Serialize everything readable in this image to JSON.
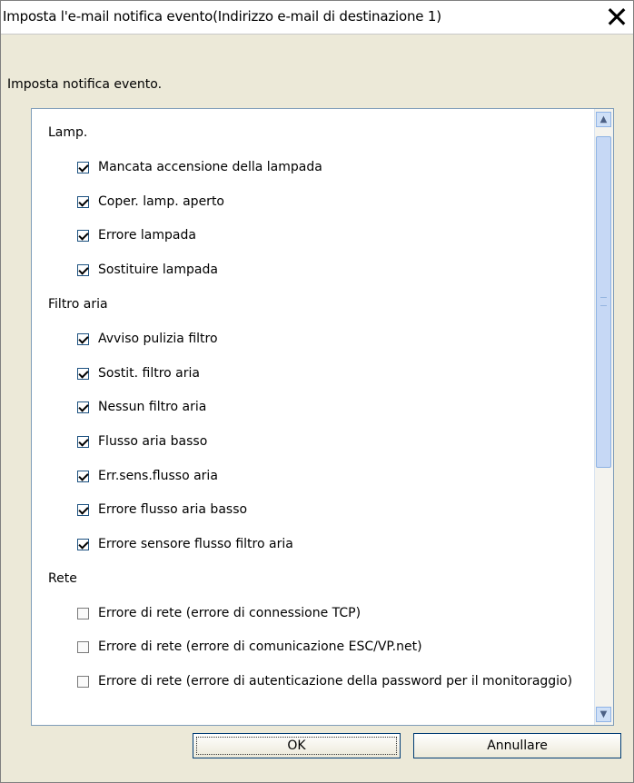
{
  "window": {
    "title": "Imposta l'e-mail notifica evento(Indirizzo e-mail di destinazione 1)",
    "close_label": "✕"
  },
  "dialog": {
    "subtitle": "Imposta notifica evento."
  },
  "list": {
    "groups": [
      {
        "label": "Lamp.",
        "items": [
          {
            "label": "Mancata accensione della lampada",
            "checked": true
          },
          {
            "label": "Coper. lamp. aperto",
            "checked": true
          },
          {
            "label": "Errore lampada",
            "checked": true
          },
          {
            "label": "Sostituire lampada",
            "checked": true
          }
        ]
      },
      {
        "label": "Filtro aria",
        "items": [
          {
            "label": "Avviso pulizia filtro",
            "checked": true
          },
          {
            "label": "Sostit. filtro aria",
            "checked": true
          },
          {
            "label": "Nessun filtro aria",
            "checked": true
          },
          {
            "label": "Flusso aria basso",
            "checked": true
          },
          {
            "label": "Err.sens.flusso aria",
            "checked": true
          },
          {
            "label": "Errore flusso aria basso",
            "checked": true
          },
          {
            "label": "Errore sensore flusso filtro aria",
            "checked": true
          }
        ]
      },
      {
        "label": "Rete",
        "items": [
          {
            "label": "Errore di rete (errore di connessione TCP)",
            "checked": false
          },
          {
            "label": "Errore di rete (errore di comunicazione ESC/VP.net)",
            "checked": false
          },
          {
            "label": "Errore di rete (errore di autenticazione della password per il monitoraggio)",
            "checked": false
          }
        ]
      }
    ]
  },
  "buttons": {
    "ok_label": "OK",
    "cancel_label": "Annullare"
  },
  "icons": {
    "scroll_up": "chevron-up-icon",
    "scroll_down": "chevron-down-icon",
    "close": "close-icon"
  }
}
